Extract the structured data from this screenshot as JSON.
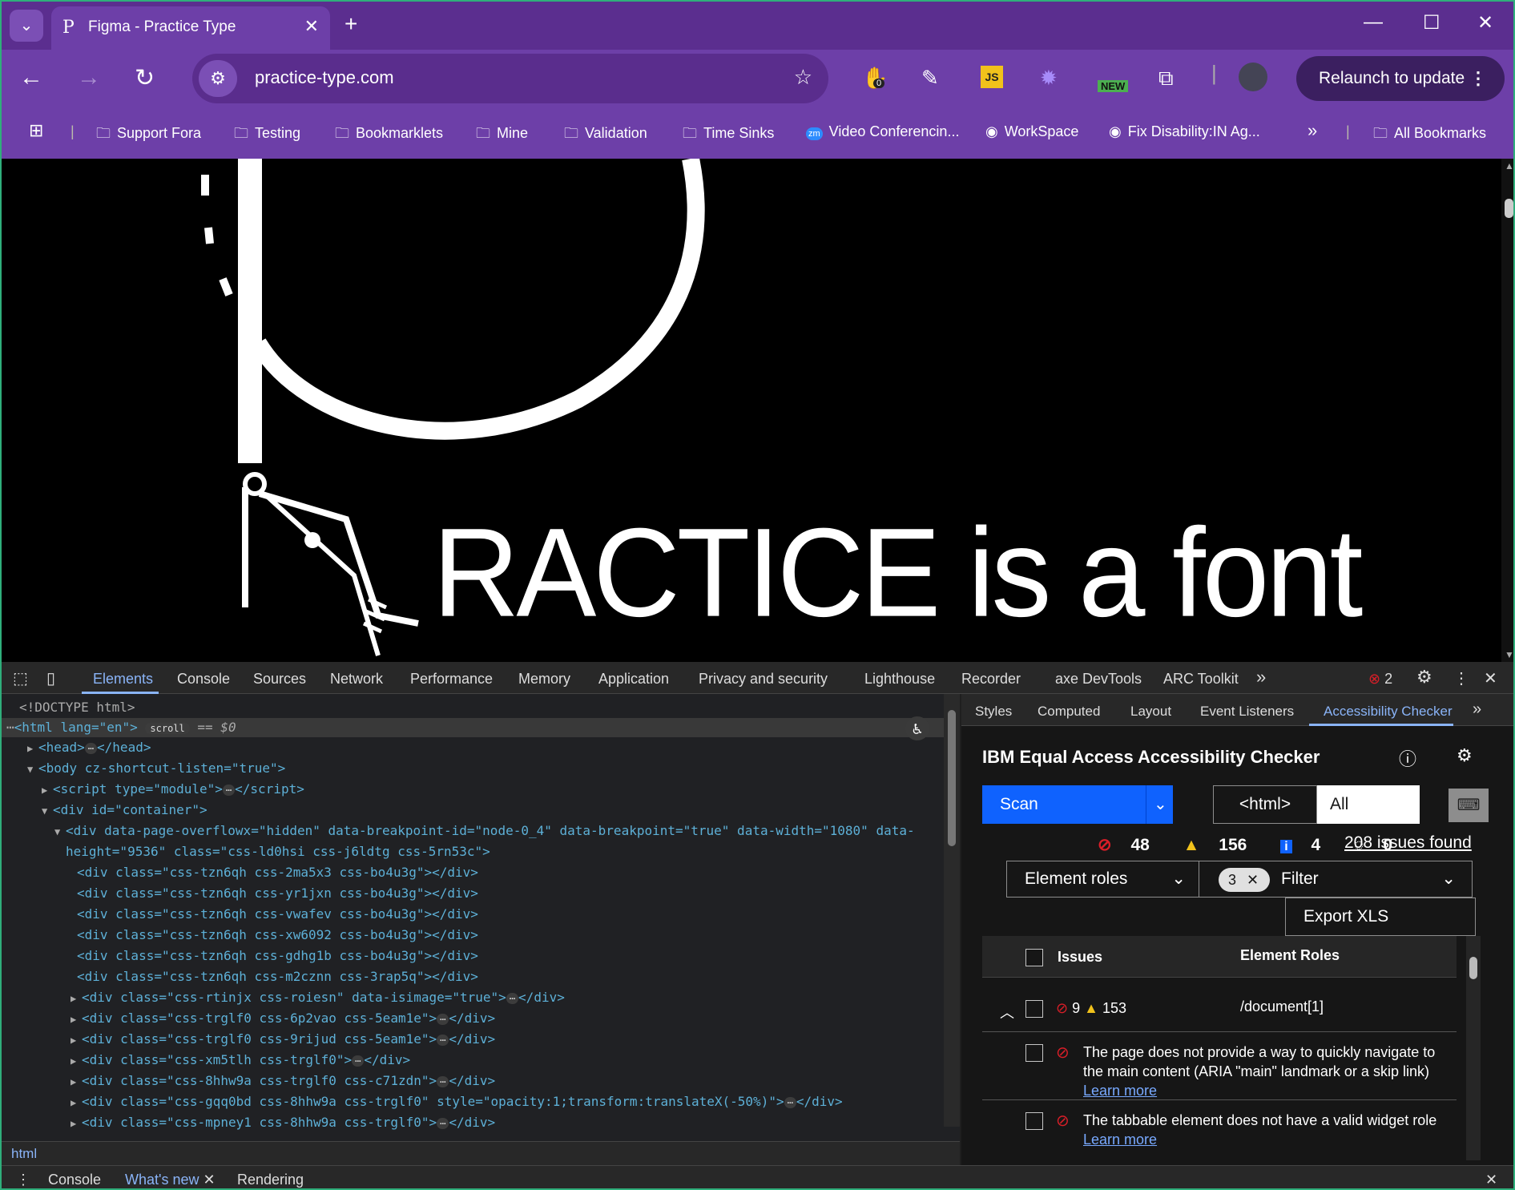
{
  "browser": {
    "tab_title": "Figma - Practice Type",
    "url": "practice-type.com",
    "relaunch_label": "Relaunch to update",
    "ext_badge_count": "0",
    "ext_new_badge": "NEW"
  },
  "bookmarks": [
    {
      "label": "Support Fora",
      "icon": "folder-icon"
    },
    {
      "label": "Testing",
      "icon": "folder-icon"
    },
    {
      "label": "Bookmarklets",
      "icon": "folder-icon"
    },
    {
      "label": "Mine",
      "icon": "folder-icon"
    },
    {
      "label": "Validation",
      "icon": "folder-icon"
    },
    {
      "label": "Time Sinks",
      "icon": "folder-icon"
    },
    {
      "label": "Video Conferencin...",
      "icon": "zoom-icon"
    },
    {
      "label": "WorkSpace",
      "icon": "site-icon"
    },
    {
      "label": "Fix Disability:IN Ag...",
      "icon": "site-icon"
    },
    {
      "label": "All Bookmarks",
      "icon": "folder-icon"
    }
  ],
  "page": {
    "headline": "RACTICE is a font"
  },
  "devtools": {
    "tabs": [
      "Elements",
      "Console",
      "Sources",
      "Network",
      "Performance",
      "Memory",
      "Application",
      "Privacy and security",
      "Lighthouse",
      "Recorder",
      "axe DevTools",
      "ARC Toolkit"
    ],
    "error_count": "2",
    "side_tabs": [
      "Styles",
      "Computed",
      "Layout",
      "Event Listeners",
      "Accessibility Checker"
    ],
    "breadcrumb": "html",
    "drawer_tabs": [
      "Console",
      "What's new",
      "Rendering"
    ],
    "dom": {
      "doctype": "<!DOCTYPE html>",
      "html_open": "<html lang=\"en\">",
      "scroll_badge": "scroll",
      "selected_hint": "== $0",
      "lines": [
        "<head>",
        "<body cz-shortcut-listen=\"true\">",
        "<script type=\"module\">",
        "<div id=\"container\">",
        "<div data-page-overflowx=\"hidden\" data-breakpoint-id=\"node-0_4\" data-breakpoint=\"true\" data-width=\"1080\" data-",
        "height=\"9536\" class=\"css-ld0hsi css-j6ldtg css-5rn53c\">",
        "<div class=\"css-tzn6qh css-2ma5x3 css-bo4u3g\"></div>",
        "<div class=\"css-tzn6qh css-yr1jxn css-bo4u3g\"></div>",
        "<div class=\"css-tzn6qh css-vwafev css-bo4u3g\"></div>",
        "<div class=\"css-tzn6qh css-xw6092 css-bo4u3g\"></div>",
        "<div class=\"css-tzn6qh css-gdhg1b css-bo4u3g\"></div>",
        "<div class=\"css-tzn6qh css-m2cznn css-3rap5q\"></div>",
        "<div class=\"css-rtinjx css-roiesn\" data-isimage=\"true\">",
        "<div class=\"css-trglf0 css-6p2vao css-5eam1e\">",
        "<div class=\"css-trglf0 css-9rijud css-5eam1e\">",
        "<div class=\"css-xm5tlh css-trglf0\">",
        "<div class=\"css-8hhw9a css-trglf0 css-c71zdn\">",
        "<div class=\"css-gqq0bd css-8hhw9a css-trglf0\" style=\"opacity:1;transform:translateX(-50%)\">",
        "<div class=\"css-mpney1 css-8hhw9a css-trglf0\">"
      ]
    }
  },
  "checker": {
    "title": "IBM Equal Access Accessibility Checker",
    "scan_label": "Scan",
    "scope_value": "<html>",
    "rule_value": "All",
    "violations": "48",
    "needs_review": "156",
    "recommendations": "4",
    "hidden": "0",
    "issues_found": "208 issues found",
    "group_by": "Element roles",
    "filter_chip_count": "3",
    "filter_label": "Filter",
    "export_label": "Export XLS",
    "col_issues": "Issues",
    "col_roles": "Element Roles",
    "group_row": {
      "violations": "9",
      "review": "153",
      "role": "/document[1]"
    },
    "issues": [
      {
        "text": "The page does not provide a way to quickly navigate to the main content (ARIA \"main\" landmark or a skip link)",
        "link": "Learn more"
      },
      {
        "text": "The tabbable element does not have a valid widget role",
        "link": "Learn more"
      }
    ]
  },
  "colors": {
    "titlebar": "#5b2e8f",
    "toolbar": "#6d3fa8",
    "scan_button": "#0f62fe",
    "violation": "#da1e28",
    "warning": "#f1c21b"
  }
}
